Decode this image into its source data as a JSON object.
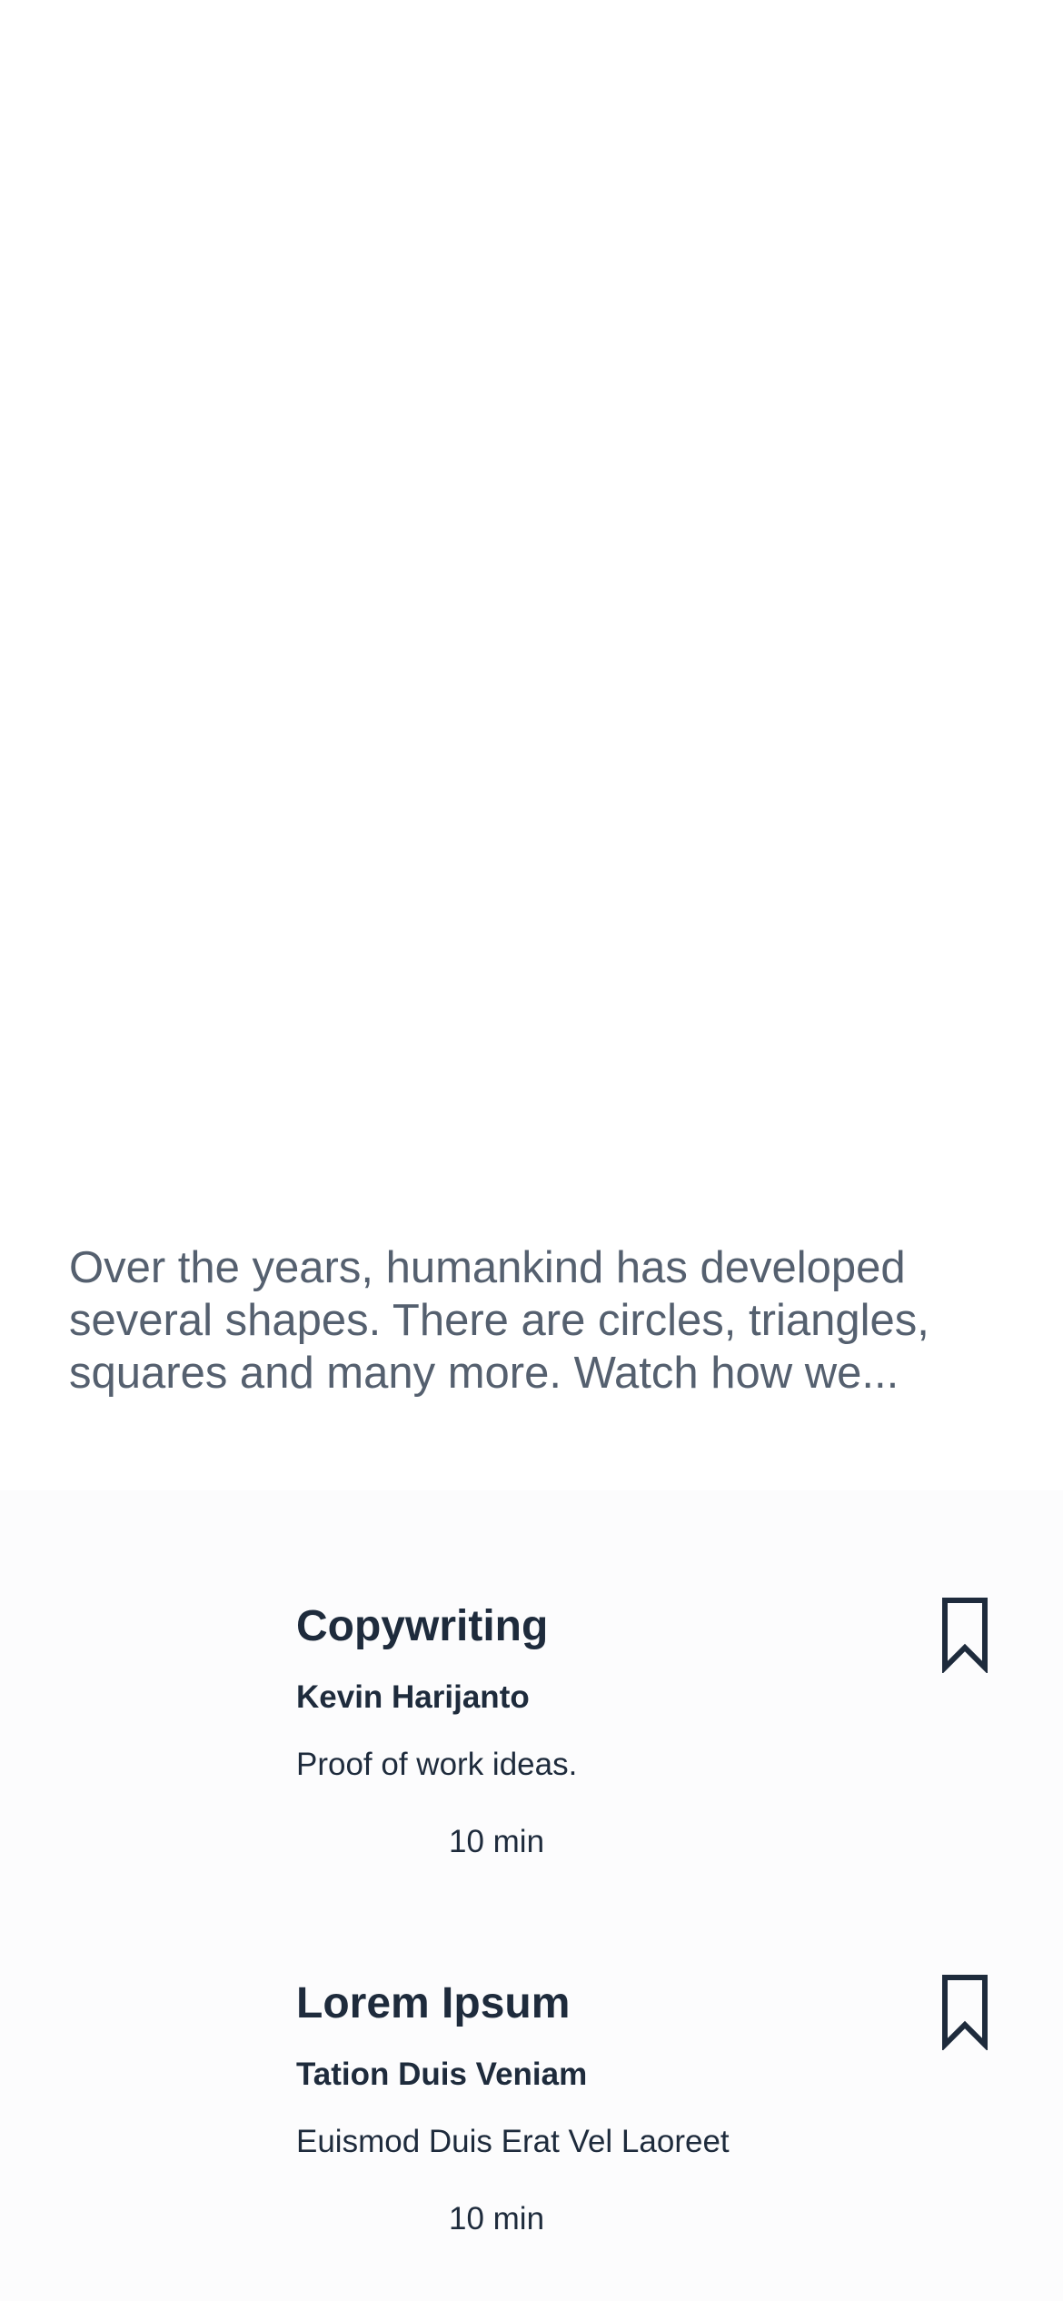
{
  "article": {
    "excerpt": "Over the years, humankind has developed several shapes. There are circles, triangles, squares and many more. Watch how we..."
  },
  "cards": [
    {
      "title": "Copywriting",
      "author": "Kevin Harijanto",
      "description": "Proof of work ideas.",
      "duration": "10 min",
      "icon": "bookmark-icon"
    },
    {
      "title": "Lorem Ipsum",
      "author": "Tation Duis Veniam",
      "description": "Euismod Duis Erat Vel Laoreet",
      "duration": "10 min",
      "icon": "bookmark-icon"
    }
  ],
  "colors": {
    "text_primary": "#1e2b3c",
    "text_secondary": "#55606f",
    "background": "#ffffff"
  }
}
